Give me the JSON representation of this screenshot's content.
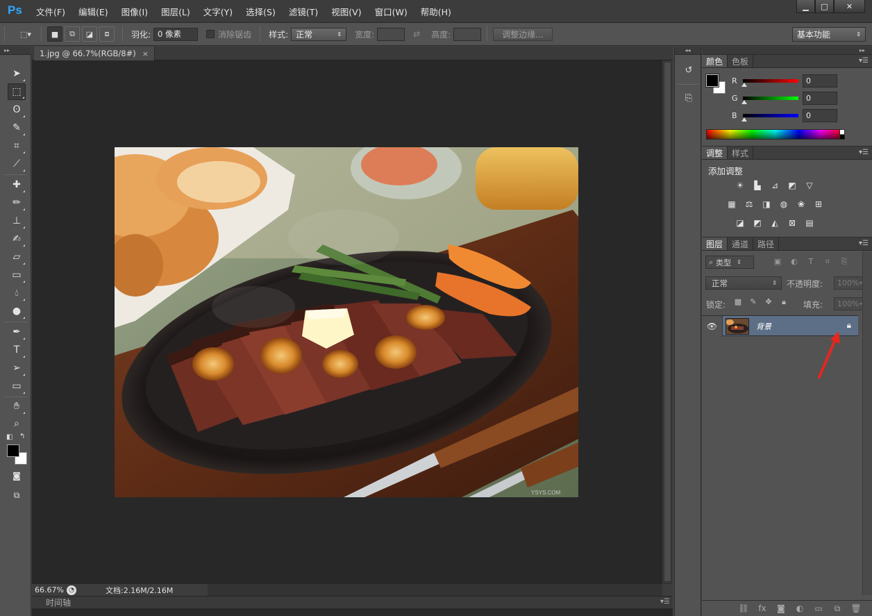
{
  "app": {
    "logo": "Ps"
  },
  "menu": [
    "文件(F)",
    "编辑(E)",
    "图像(I)",
    "图层(L)",
    "文字(Y)",
    "选择(S)",
    "滤镜(T)",
    "视图(V)",
    "窗口(W)",
    "帮助(H)"
  ],
  "options": {
    "feather_label": "羽化:",
    "feather_value": "0 像素",
    "antialias_label": "消除锯齿",
    "style_label": "样式:",
    "style_value": "正常",
    "width_label": "宽度:",
    "height_label": "高度:",
    "refine_edge": "调整边缘...",
    "workspace": "基本功能"
  },
  "document": {
    "tab_title": "1.jpg @ 66.7%(RGB/8#)",
    "tab_close": "×",
    "zoom": "66.67%",
    "doc_info": "文档:2.16M/2.16M",
    "timeline": "时间轴",
    "watermark": "YSYS.COM"
  },
  "color_panel": {
    "tabs": [
      "颜色",
      "色板"
    ],
    "channels": [
      {
        "label": "R",
        "value": "0",
        "color": "#ff0000"
      },
      {
        "label": "G",
        "value": "0",
        "color": "#00ff00"
      },
      {
        "label": "B",
        "value": "0",
        "color": "#0000ff"
      }
    ]
  },
  "adjust_panel": {
    "tabs": [
      "调整",
      "样式"
    ],
    "title": "添加调整",
    "icons_row1": [
      "brightness-icon",
      "levels-icon",
      "curves-icon",
      "exposure-icon",
      "vibrance-icon"
    ],
    "icons_row2": [
      "hue-saturation-icon",
      "color-balance-icon",
      "black-white-icon",
      "photo-filter-icon",
      "channel-mixer-icon",
      "color-lookup-icon"
    ],
    "icons_row3": [
      "invert-icon",
      "posterize-icon",
      "threshold-icon",
      "selective-color-icon",
      "gradient-map-icon"
    ]
  },
  "layers_panel": {
    "tabs": [
      "图层",
      "通道",
      "路径"
    ],
    "filter": "类型",
    "blend_mode": "正常",
    "opacity_label": "不透明度:",
    "opacity_value": "100%",
    "lock_label": "锁定:",
    "fill_label": "填充:",
    "fill_value": "100%",
    "layers": [
      {
        "name": "背景",
        "visible": true,
        "locked": true
      }
    ]
  },
  "colors": {
    "accent": "#31a8ff",
    "selected_layer": "#5d6f86",
    "arrow": "#e8261c"
  }
}
